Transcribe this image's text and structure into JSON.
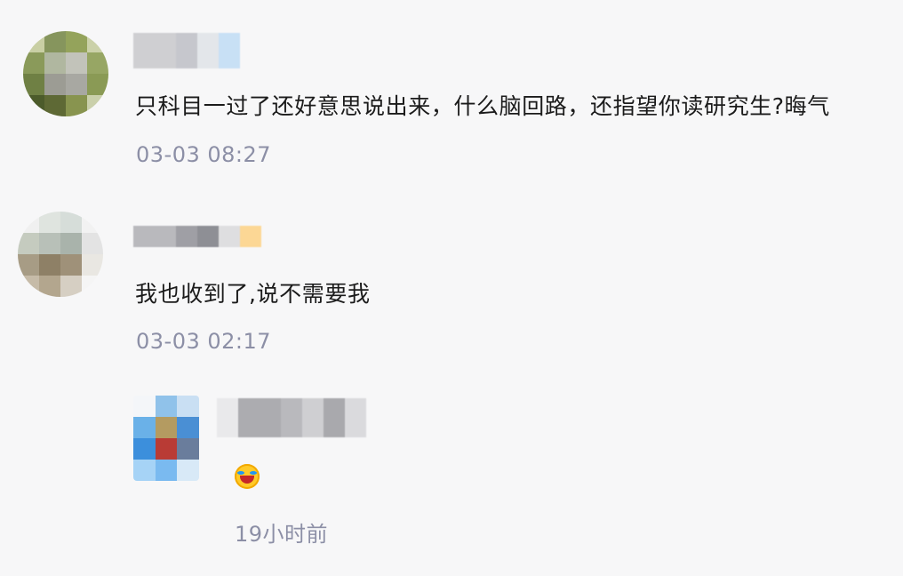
{
  "comments": [
    {
      "text": "只科目一过了还好意思说出来，什么脑回路，还指望你读研究生?晦气",
      "time": "03-03 08:27"
    },
    {
      "text": "我也收到了,说不需要我",
      "time": "03-03 02:17"
    },
    {
      "time": "19小时前",
      "emoji": "crying-laughing-emoji"
    }
  ]
}
